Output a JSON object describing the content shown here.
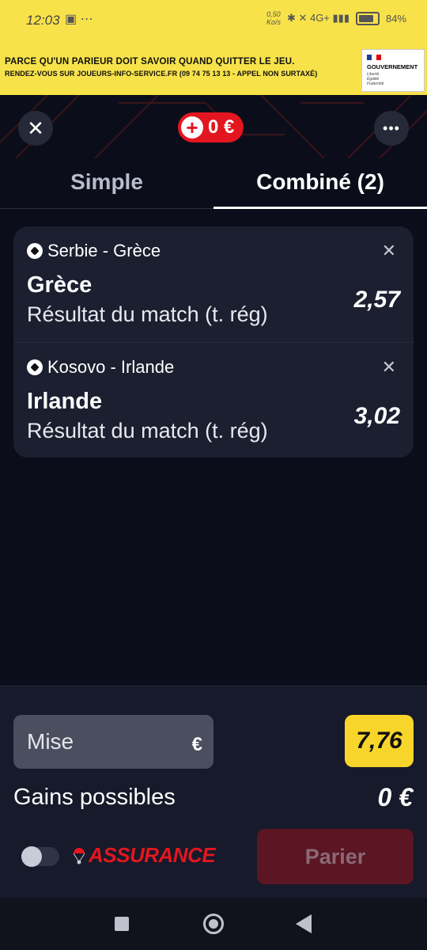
{
  "status_bar": {
    "time": "12:03",
    "left_icons": "▣ ⋯",
    "speed_value": "0,50",
    "speed_unit": "Ko/s",
    "signal_icons": "✱ ✕ 4G+ ▮▮▮",
    "battery_percent": "84%"
  },
  "banner": {
    "line1": "PARCE QU'UN PARIEUR DOIT SAVOIR QUAND QUITTER LE JEU.",
    "line2": "RENDEZ-VOUS SUR JOUEURS-INFO-SERVICE.FR (09 74 75 13 13 - APPEL NON SURTAXÉ)",
    "gov_name": "GOUVERNEMENT",
    "gov_motto": [
      "Liberté",
      "Égalité",
      "Fraternité"
    ]
  },
  "header": {
    "close_icon": "✕",
    "balance": "0 €",
    "more_icon": "•••"
  },
  "tabs": [
    {
      "label": "Simple",
      "active": false
    },
    {
      "label": "Combiné (2)",
      "active": true
    }
  ],
  "selections": [
    {
      "match": "Serbie - Grèce",
      "pick": "Grèce",
      "market": "Résultat du match (t. rég)",
      "odd": "2,57"
    },
    {
      "match": "Kosovo - Irlande",
      "pick": "Irlande",
      "market": "Résultat du match (t. rég)",
      "odd": "3,02"
    }
  ],
  "bet": {
    "stake_label": "Mise",
    "currency": "€",
    "total_odds": "7,76",
    "winnings_label": "Gains possibles",
    "winnings_value": "0 €",
    "insurance_label": "ASSURANCE",
    "insurance_enabled": false,
    "submit_label": "Parier"
  },
  "colors": {
    "accent_yellow": "#f8d52a",
    "brand_red": "#e3161f",
    "background": "#0b0e1a",
    "card": "#1b1f30"
  }
}
